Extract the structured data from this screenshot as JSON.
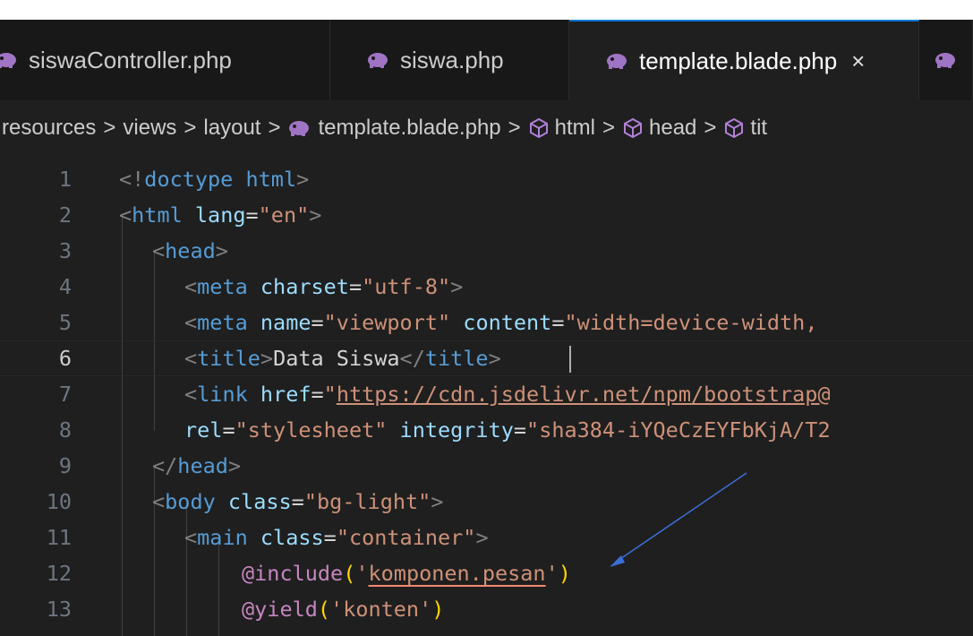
{
  "tabs": [
    {
      "label": "siswaController.php",
      "active": false
    },
    {
      "label": "siswa.php",
      "active": false
    },
    {
      "label": "template.blade.php",
      "active": true,
      "close": "×"
    },
    {
      "label": "",
      "active": false
    }
  ],
  "breadcrumbs": {
    "items": [
      "resources",
      "views",
      "layout",
      "template.blade.php",
      "html",
      "head",
      "tit"
    ],
    "separator": ">"
  },
  "code": {
    "current_line": 6,
    "line_numbers": [
      "1",
      "2",
      "3",
      "4",
      "5",
      "6",
      "7",
      "8",
      "9",
      "10",
      "11",
      "12",
      "13"
    ],
    "l1": {
      "open": "<!",
      "tag": "doctype",
      "attr": "html",
      "close": ">"
    },
    "l2": {
      "open": "<",
      "tag": "html",
      "attr": "lang",
      "eq": "=",
      "val": "\"en\"",
      "close": ">"
    },
    "l3": {
      "open": "<",
      "tag": "head",
      "close": ">"
    },
    "l4": {
      "open": "<",
      "tag": "meta",
      "attr": "charset",
      "eq": "=",
      "val": "\"utf-8\"",
      "close": ">"
    },
    "l5": {
      "open": "<",
      "tag": "meta",
      "attr1": "name",
      "eq1": "=",
      "val1": "\"viewport\"",
      "attr2": "content",
      "eq2": "=",
      "val2": "\"width=device-width,"
    },
    "l6": {
      "open": "<",
      "tag": "title",
      "close": ">",
      "text": "Data Siswa",
      "open2": "</",
      "tag2": "title",
      "close2": ">"
    },
    "l7": {
      "open": "<",
      "tag": "link",
      "attr": "href",
      "eq": "=",
      "q": "\"",
      "url": "https://cdn.jsdelivr.net/npm/bootstrap@"
    },
    "l8": {
      "attr1": "rel",
      "eq1": "=",
      "val1": "\"stylesheet\"",
      "attr2": "integrity",
      "eq2": "=",
      "val2": "\"sha384-iYQeCzEYFbKjA/T2"
    },
    "l9": {
      "open": "</",
      "tag": "head",
      "close": ">"
    },
    "l10": {
      "open": "<",
      "tag": "body",
      "attr": "class",
      "eq": "=",
      "val": "\"bg-light\"",
      "close": ">"
    },
    "l11": {
      "open": "<",
      "tag": "main",
      "attr": "class",
      "eq": "=",
      "val": "\"container\"",
      "close": ">"
    },
    "l12": {
      "directive": "@include",
      "p1": "(",
      "q1": "'",
      "arg": "komponen.pesan",
      "q2": "'",
      "p2": ")"
    },
    "l13": {
      "directive": "@yield",
      "p1": "(",
      "arg": "'konten'",
      "p2": ")"
    }
  },
  "colors": {
    "editor_bg": "#1f1f1f",
    "tag": "#569cd6",
    "attribute": "#9cdcfe",
    "string": "#ce9178",
    "annotation_arrow": "#3b6fd6"
  }
}
